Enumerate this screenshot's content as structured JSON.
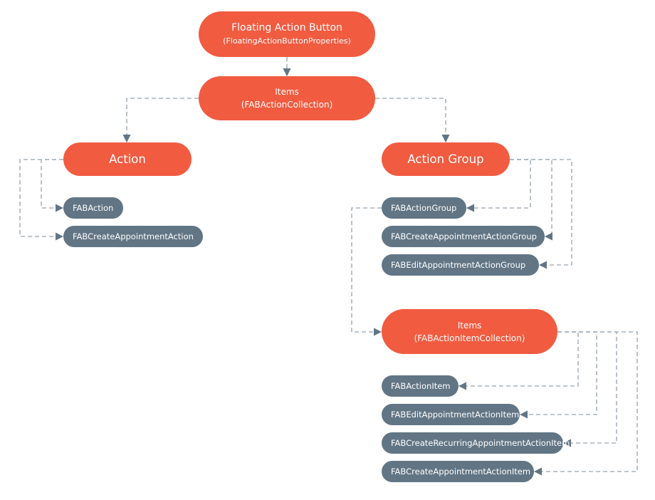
{
  "colors": {
    "primary_node": "#f15b40",
    "child_node": "#617585",
    "connector": "#a9b4bc"
  },
  "nodes": {
    "fab": {
      "title": "Floating Action Button",
      "subtitle": "(FloatingActionButtonProperties)"
    },
    "items": {
      "title": "Items",
      "subtitle": "(FABActionCollection)"
    },
    "action": {
      "title": "Action"
    },
    "action_group": {
      "title": "Action Group"
    },
    "action_children": [
      "FABAction",
      "FABCreateAppointmentAction"
    ],
    "group_children": [
      "FABActionGroup",
      "FABCreateAppointmentActionGroup",
      "FABEditAppointmentActionGroup"
    ],
    "group_items": {
      "title": "Items",
      "subtitle": "(FABActionItemCollection)"
    },
    "item_children": [
      "FABActionItem",
      "FABEditAppointmentActionItem",
      "FABCreateRecurringAppointmentActionItem",
      "FABCreateAppointmentActionItem"
    ]
  }
}
